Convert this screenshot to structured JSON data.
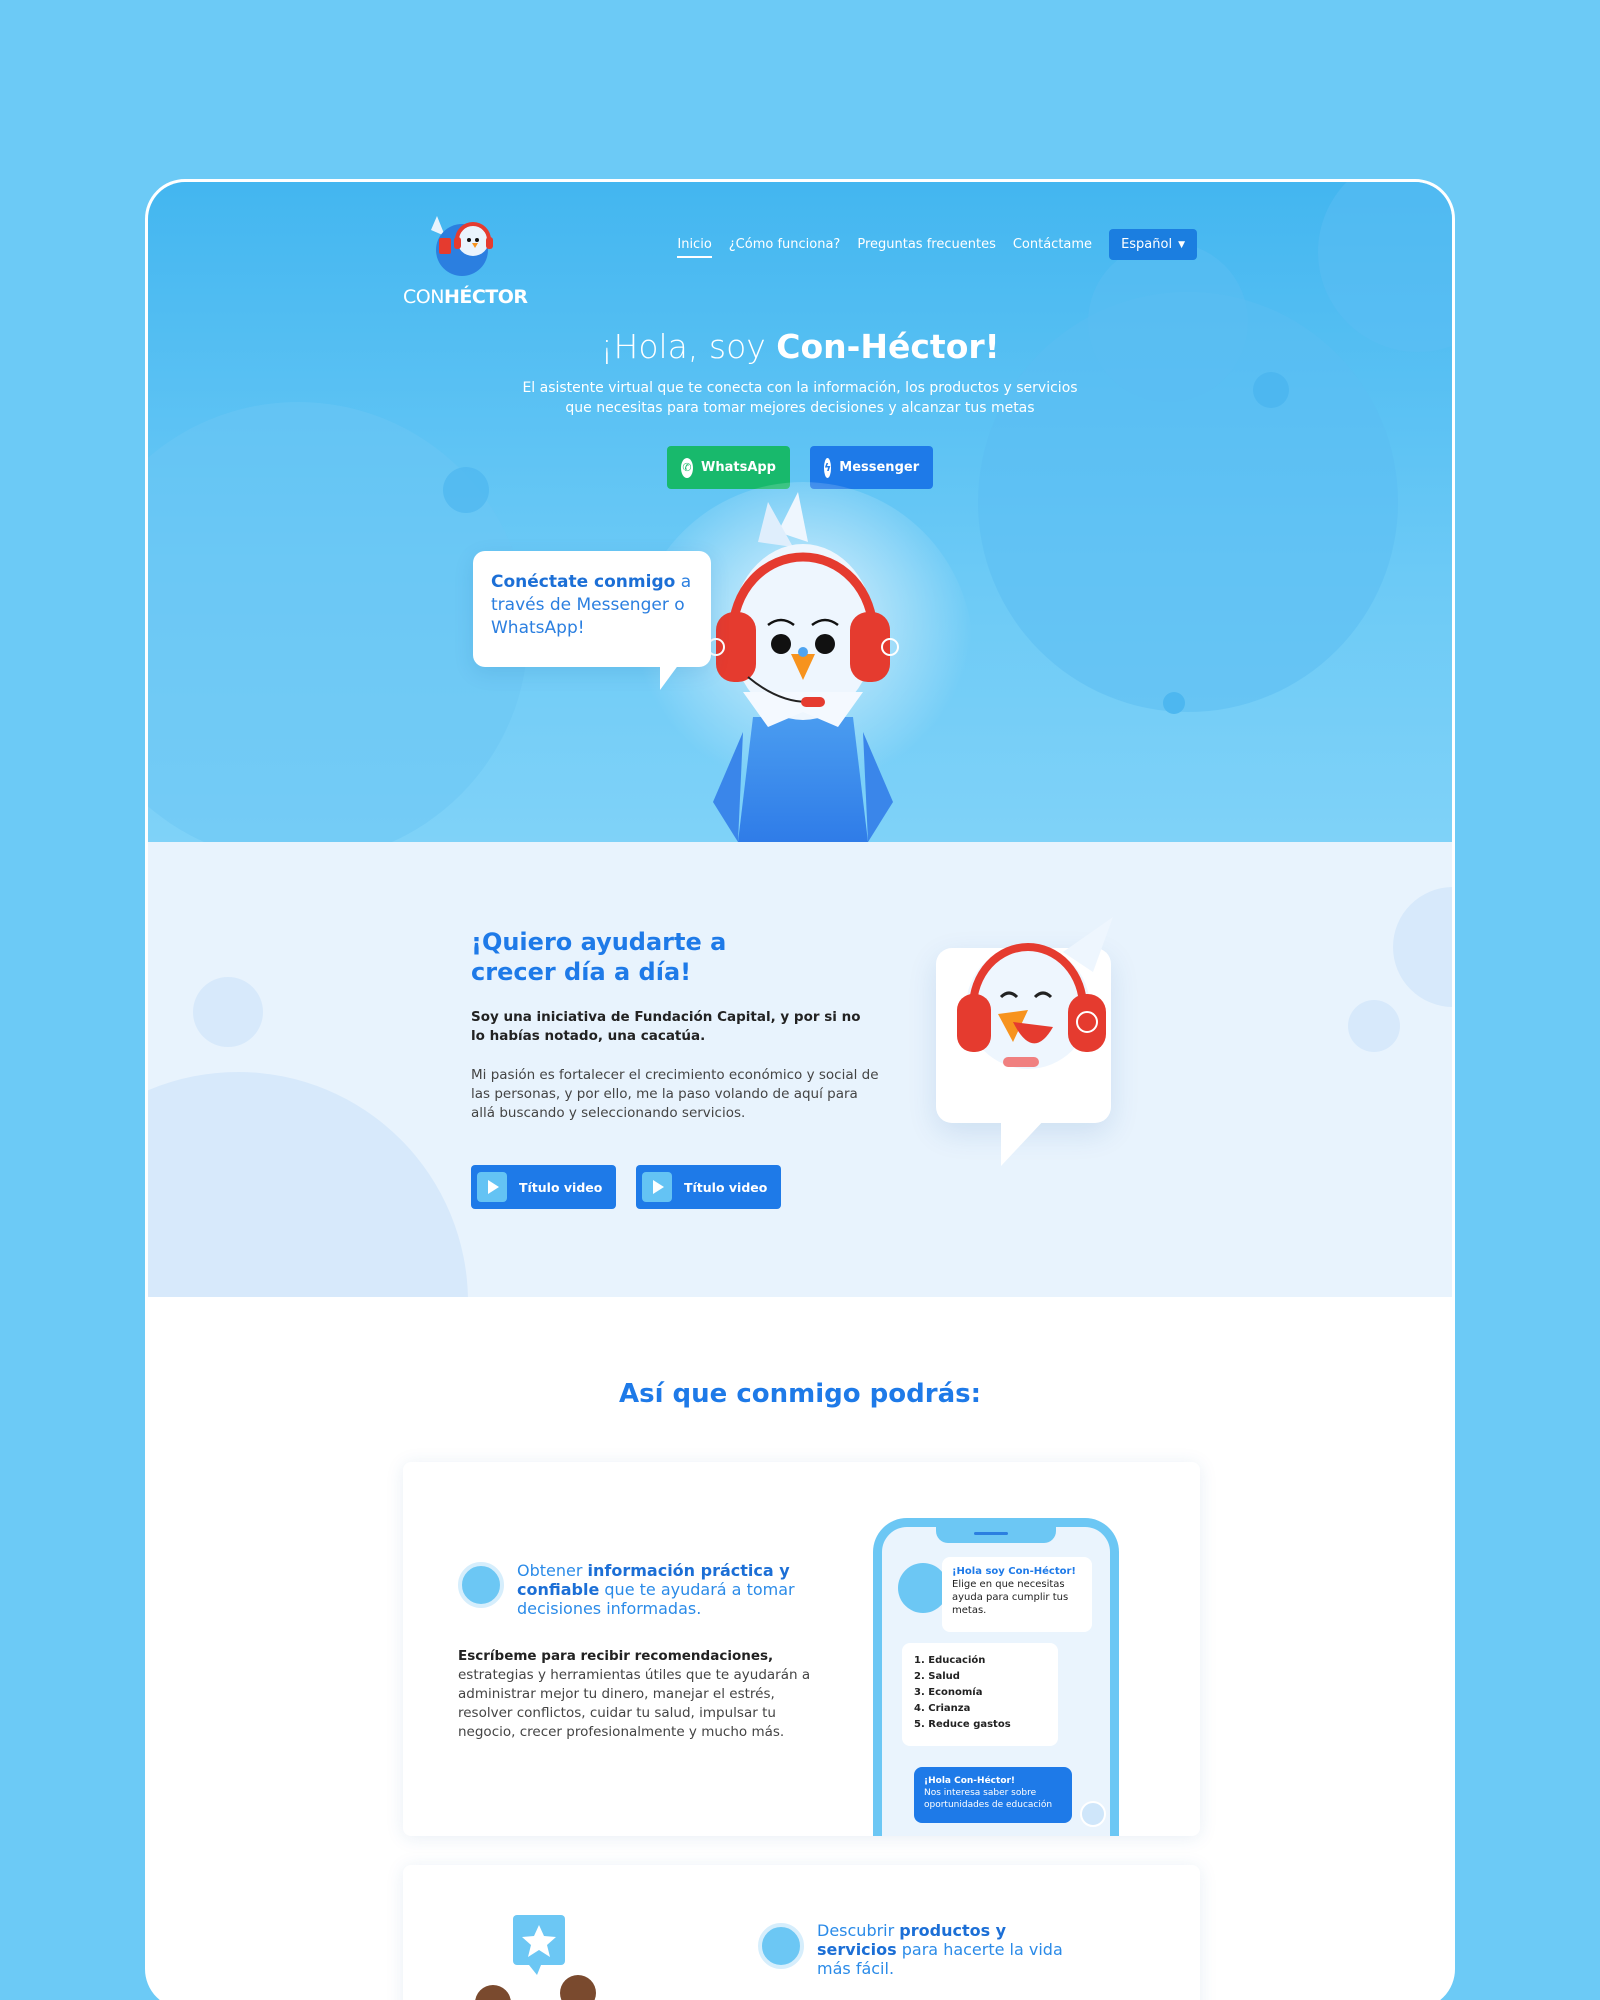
{
  "header": {
    "logo": {
      "con": "CON",
      "hector": "HÉCTOR"
    },
    "nav": [
      {
        "label": "Inicio",
        "active": true
      },
      {
        "label": "¿Cómo funciona?"
      },
      {
        "label": "Preguntas frecuentes"
      },
      {
        "label": "Contáctame"
      }
    ],
    "language": "Español"
  },
  "hero": {
    "title_light": "¡Hola, soy ",
    "title_bold": "Con-Héctor!",
    "subtitle": "El asistente virtual que te conecta con la información, los productos y servicios que necesitas para tomar mejores decisiones y alcanzar tus metas",
    "whatsapp_label": "WhatsApp",
    "messenger_label": "Messenger",
    "bubble_bold": "Conéctate conmigo",
    "bubble_rest": " a través de Messenger o WhatsApp!"
  },
  "about": {
    "title": "¡Quiero ayudarte a crecer día a día!",
    "lead": "Soy una iniciativa de Fundación Capital, y por si no lo habías notado, una cacatúa.",
    "body": "Mi pasión es fortalecer el crecimiento económico y social de las personas, y por ello, me la paso volando de aquí para allá buscando y seleccionando servicios.",
    "video_buttons": [
      "Título video",
      "Título video"
    ]
  },
  "features": {
    "title": "Así que conmigo podrás:",
    "card1": {
      "title_pre": "Obtener ",
      "title_bold": "información práctica y confiable",
      "title_post": " que te ayudará a tomar decisiones informadas.",
      "desc_bold": "Escríbeme para recibir recomendaciones,",
      "desc": " estrategias y herramientas útiles que te ayudarán a administrar mejor tu dinero, manejar el estrés, resolver conflictos, cuidar tu salud, impulsar tu negocio, crecer profesionalmente y mucho más.",
      "phone": {
        "msg_title": "¡Hola soy Con-Héctor!",
        "msg_body": "Elige en que necesitas ayuda para cumplir tus metas.",
        "options": [
          "1. Educación",
          "2. Salud",
          "3. Economía",
          "4. Crianza",
          "5. Reduce gastos"
        ],
        "reply_title": "¡Hola Con-Héctor!",
        "reply_body": "Nos interesa saber sobre oportunidades de educación"
      }
    },
    "card2": {
      "title_pre": "Descubrir ",
      "title_bold": "productos y servicios",
      "title_post": " para hacerte la vida más fácil."
    }
  },
  "colors": {
    "sky": "#6ccaf6",
    "brand_blue": "#1e7ae8",
    "whatsapp": "#18b96c",
    "headphone_red": "#e53b2f"
  }
}
